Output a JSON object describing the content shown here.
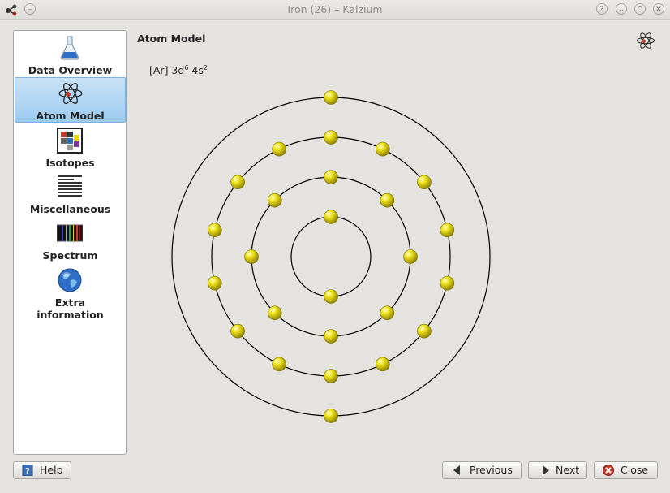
{
  "window": {
    "title": "Iron (26) – Kalzium"
  },
  "sidebar": {
    "items": [
      {
        "label": "Data Overview"
      },
      {
        "label": "Atom Model"
      },
      {
        "label": "Isotopes"
      },
      {
        "label": "Miscellaneous"
      },
      {
        "label": "Spectrum"
      },
      {
        "label": "Extra information"
      }
    ],
    "selected": "Atom Model"
  },
  "content": {
    "title": "Atom Model",
    "config_prefix": "[Ar] 3d",
    "config_sup1": "6",
    "config_mid": " 4s",
    "config_sup2": "2"
  },
  "atom_model": {
    "shell_electrons": [
      2,
      8,
      14,
      2
    ],
    "electron_color": "#e4d800",
    "shell_color": "#000000"
  },
  "buttons": {
    "help": "Help",
    "previous": "Previous",
    "next": "Next",
    "close": "Close"
  },
  "colors": {
    "selection": "#9ccbf0",
    "close_icon": "#c0392b"
  }
}
